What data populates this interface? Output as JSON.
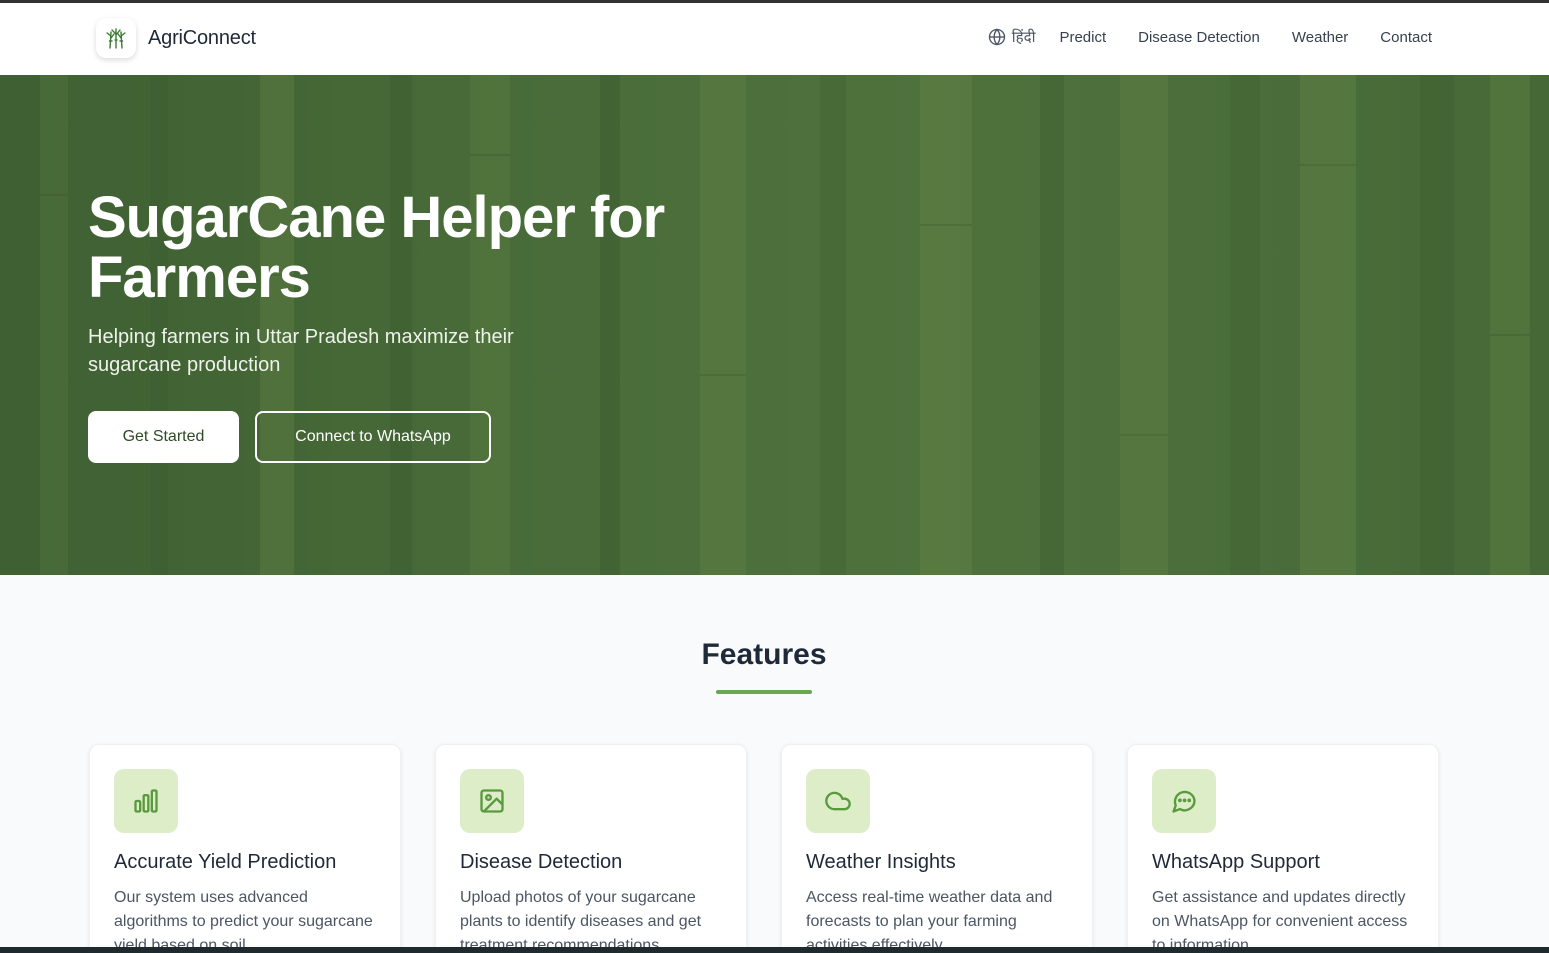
{
  "header": {
    "brand_name": "AgriConnect",
    "language_label": "हिंदी",
    "nav": [
      {
        "label": "Predict"
      },
      {
        "label": "Disease Detection"
      },
      {
        "label": "Weather"
      },
      {
        "label": "Contact"
      }
    ]
  },
  "hero": {
    "title": "SugarCane Helper for Farmers",
    "subtitle": "Helping farmers in Uttar Pradesh maximize their sugarcane production",
    "primary_button": "Get Started",
    "secondary_button": "Connect to WhatsApp"
  },
  "features": {
    "heading": "Features",
    "cards": [
      {
        "icon": "bar-chart-icon",
        "title": "Accurate Yield Prediction",
        "description": "Our system uses advanced algorithms to predict your sugarcane yield based on soil"
      },
      {
        "icon": "image-icon",
        "title": "Disease Detection",
        "description": "Upload photos of your sugarcane plants to identify diseases and get treatment recommendations"
      },
      {
        "icon": "cloud-icon",
        "title": "Weather Insights",
        "description": "Access real-time weather data and forecasts to plan your farming activities effectively"
      },
      {
        "icon": "chat-icon",
        "title": "WhatsApp Support",
        "description": "Get assistance and updates directly on WhatsApp for convenient access to information"
      }
    ]
  },
  "colors": {
    "accent": "#6aa84f",
    "icon_bg": "#dcedc8",
    "icon_stroke": "#5a9a3e",
    "hero_green": "#4d6e3d"
  }
}
